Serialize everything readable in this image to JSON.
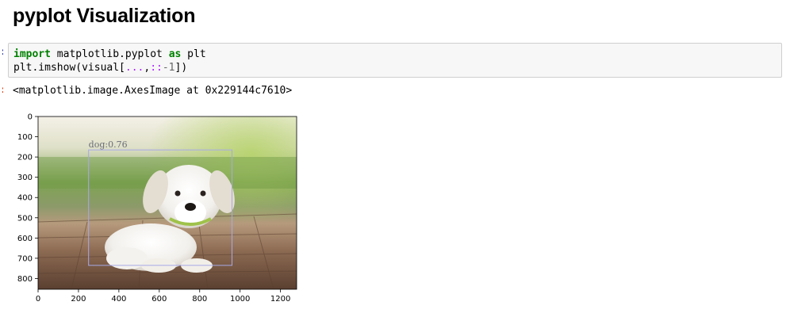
{
  "heading": "pyplot Visualization",
  "cell": {
    "line1": {
      "kw1": "import",
      "mod": " matplotlib.pyplot ",
      "kw2": "as",
      "alias": " plt"
    },
    "line2": {
      "pre": "plt.imshow(visual[",
      "slice1": "...",
      "comma": ",",
      "slice2": "::",
      "neg": "-1",
      "post": "])"
    }
  },
  "output": {
    "text": "<matplotlib.image.AxesImage at 0x229144c7610>"
  },
  "chart_data": {
    "type": "image",
    "xlim": [
      0,
      1280
    ],
    "ylim": [
      853,
      0
    ],
    "x_ticks": [
      0,
      200,
      400,
      600,
      800,
      1000,
      1200
    ],
    "y_ticks": [
      0,
      100,
      200,
      300,
      400,
      500,
      600,
      700,
      800
    ],
    "grid": false,
    "detection": {
      "label": "dog:0.76",
      "x_min": 250,
      "y_min": 165,
      "x_max": 960,
      "y_max": 735
    }
  },
  "colors": {
    "keyword": "#008000",
    "punct": "#aa22ff",
    "box": "#a7a8e6",
    "label": "#6b6d7a"
  }
}
